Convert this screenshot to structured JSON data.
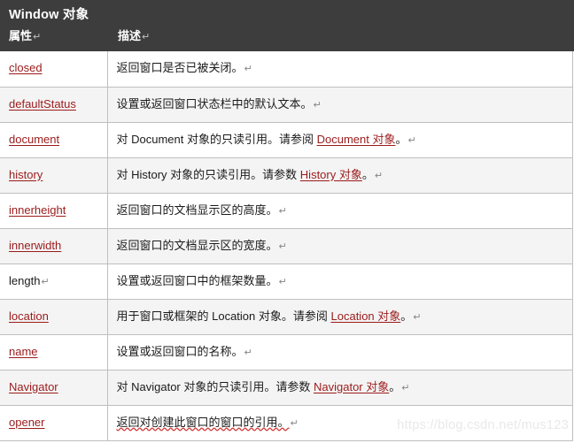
{
  "header": {
    "title": "Window 对象",
    "columns": {
      "property": "属性",
      "description": "描述"
    },
    "pilcrow": "↵",
    "background_color": "#3d3d3d",
    "text_color": "#ffffff"
  },
  "colors": {
    "link": "#9b1b1b",
    "text": "#1b1b1b",
    "border": "#bfbfbf",
    "stripe": "#f4f4f4",
    "row": "#ffffff",
    "spellcheck_underline": "#d23b3b",
    "watermark": "#e9e9e9"
  },
  "table": {
    "rows": [
      {
        "property": "closed",
        "property_is_link": true,
        "desc_prefix": "返回窗口是否已被关闭。",
        "desc_link": "",
        "desc_suffix": "",
        "has_pilcrow": true
      },
      {
        "property": "defaultStatus",
        "property_is_link": true,
        "desc_prefix": "设置或返回窗口状态栏中的默认文本。",
        "desc_link": "",
        "desc_suffix": "",
        "has_pilcrow": true
      },
      {
        "property": "document",
        "property_is_link": true,
        "desc_prefix": "对 Document 对象的只读引用。请参阅 ",
        "desc_link": "Document 对象",
        "desc_suffix": "。",
        "has_pilcrow": true
      },
      {
        "property": "history",
        "property_is_link": true,
        "desc_prefix": "对 History 对象的只读引用。请参数 ",
        "desc_link": "History 对象",
        "desc_suffix": "。",
        "has_pilcrow": true
      },
      {
        "property": "innerheight",
        "property_is_link": true,
        "desc_prefix": "返回窗口的文档显示区的高度。",
        "desc_link": "",
        "desc_suffix": "",
        "has_pilcrow": true
      },
      {
        "property": "innerwidth",
        "property_is_link": true,
        "desc_prefix": "返回窗口的文档显示区的宽度。",
        "desc_link": "",
        "desc_suffix": "",
        "has_pilcrow": true
      },
      {
        "property": "length",
        "property_is_link": false,
        "property_pilcrow": true,
        "desc_prefix": "设置或返回窗口中的框架数量。",
        "desc_link": "",
        "desc_suffix": "",
        "has_pilcrow": true
      },
      {
        "property": "location",
        "property_is_link": true,
        "desc_prefix": "用于窗口或框架的 Location 对象。请参阅 ",
        "desc_link": "Location 对象",
        "desc_suffix": "。",
        "has_pilcrow": true
      },
      {
        "property": "name",
        "property_is_link": true,
        "desc_prefix": "设置或返回窗口的名称。",
        "desc_link": "",
        "desc_suffix": "",
        "has_pilcrow": true
      },
      {
        "property": "Navigator",
        "property_is_link": true,
        "desc_prefix": "对 Navigator 对象的只读引用。请参数 ",
        "desc_link": "Navigator 对象",
        "desc_suffix": "。",
        "has_pilcrow": true
      },
      {
        "property": "opener",
        "property_is_link": true,
        "desc_prefix": "返回对创建此窗口的窗口的引用。",
        "desc_link": "",
        "desc_suffix": "",
        "has_pilcrow": true,
        "desc_spellcheck": true
      }
    ]
  },
  "watermark": {
    "text": "https://blog.csdn.net/mus123"
  }
}
